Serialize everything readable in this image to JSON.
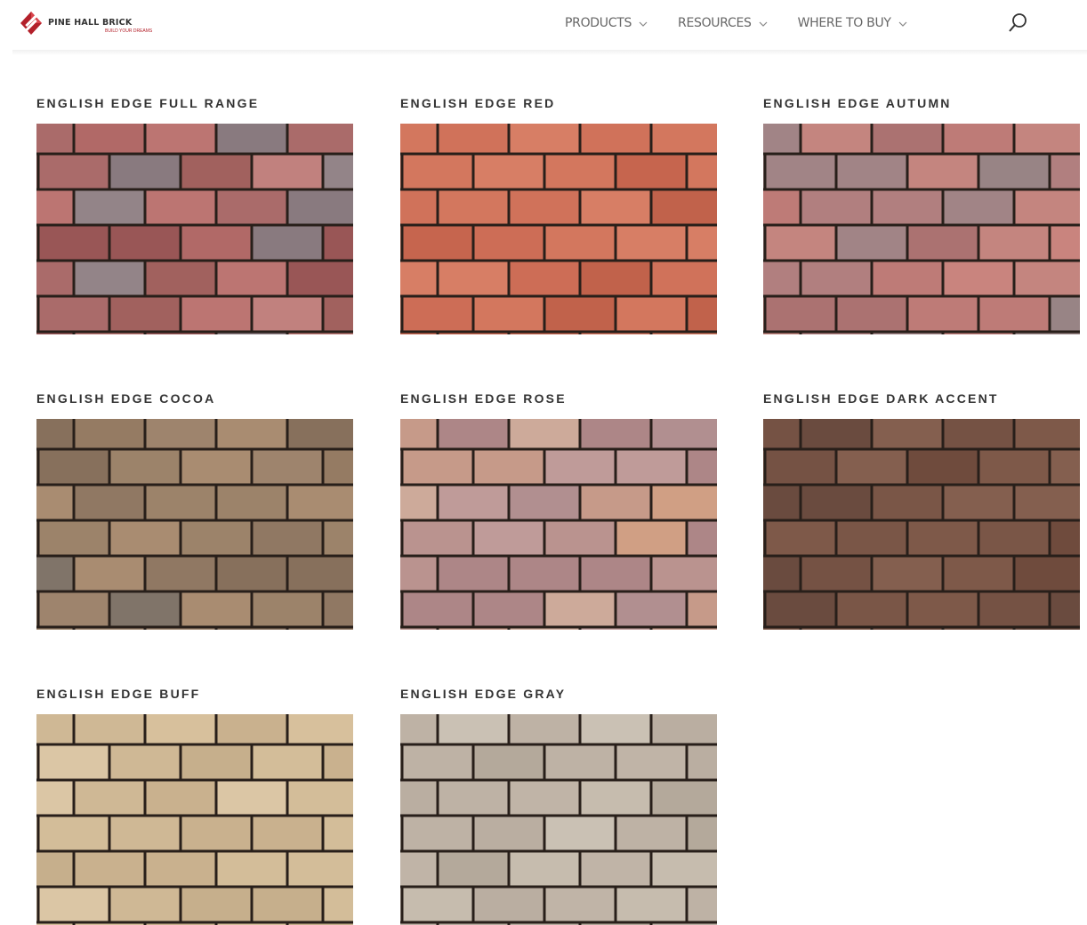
{
  "header": {
    "logo": {
      "name": "PINE HALL BRICK",
      "tagline": "BUILD YOUR DREAMS",
      "brand_color": "#b3202a"
    },
    "nav": [
      {
        "label": "PRODUCTS",
        "icon": "chevron-down-icon"
      },
      {
        "label": "RESOURCES",
        "icon": "chevron-down-icon"
      },
      {
        "label": "WHERE TO BUY",
        "icon": "chevron-down-icon"
      }
    ],
    "search_icon": "search-icon"
  },
  "products": [
    {
      "title": "ENGLISH EDGE FULL RANGE",
      "colors": [
        "#b96e6c",
        "#c47a77",
        "#a86562",
        "#8f7f85",
        "#b1706f",
        "#9a8a8e",
        "#c98784",
        "#a05a5a"
      ]
    },
    {
      "title": "ENGLISH EDGE RED",
      "colors": [
        "#d6725a",
        "#cf6a52",
        "#dc7c62",
        "#c9664f",
        "#d9775e",
        "#e0846a"
      ]
    },
    {
      "title": "ENGLISH EDGE AUTUMN",
      "colors": [
        "#c6807c",
        "#b98585",
        "#a88a8c",
        "#cd8b85",
        "#b27776",
        "#9f8a8b",
        "#d28a84"
      ]
    },
    {
      "title": "ENGLISH EDGE COCOA",
      "colors": [
        "#9c8068",
        "#a58a72",
        "#8d7560",
        "#b09276",
        "#86796e",
        "#a3896f",
        "#967d68"
      ]
    },
    {
      "title": "ENGLISH EDGE ROSE",
      "colors": [
        "#c29a95",
        "#cfa18f",
        "#b99596",
        "#d9a68a",
        "#c7a2a0",
        "#b58c8d",
        "#d6b1a1"
      ]
    },
    {
      "title": "ENGLISH EDGE DARK ACCENT",
      "colors": [
        "#7a5647",
        "#845d4c",
        "#6f4f42",
        "#8a6353",
        "#744f40",
        "#7f5a4a"
      ]
    },
    {
      "title": "ENGLISH EDGE BUFF",
      "colors": [
        "#d8c09c",
        "#e0c8a3",
        "#d2b994",
        "#dcc5a0",
        "#cfb792",
        "#e4cfac"
      ]
    },
    {
      "title": "ENGLISH EDGE GRAY",
      "colors": [
        "#c8bcae",
        "#c2b6a8",
        "#cfc4b6",
        "#bcb0a2",
        "#d3c9bc",
        "#c6baac"
      ]
    }
  ]
}
